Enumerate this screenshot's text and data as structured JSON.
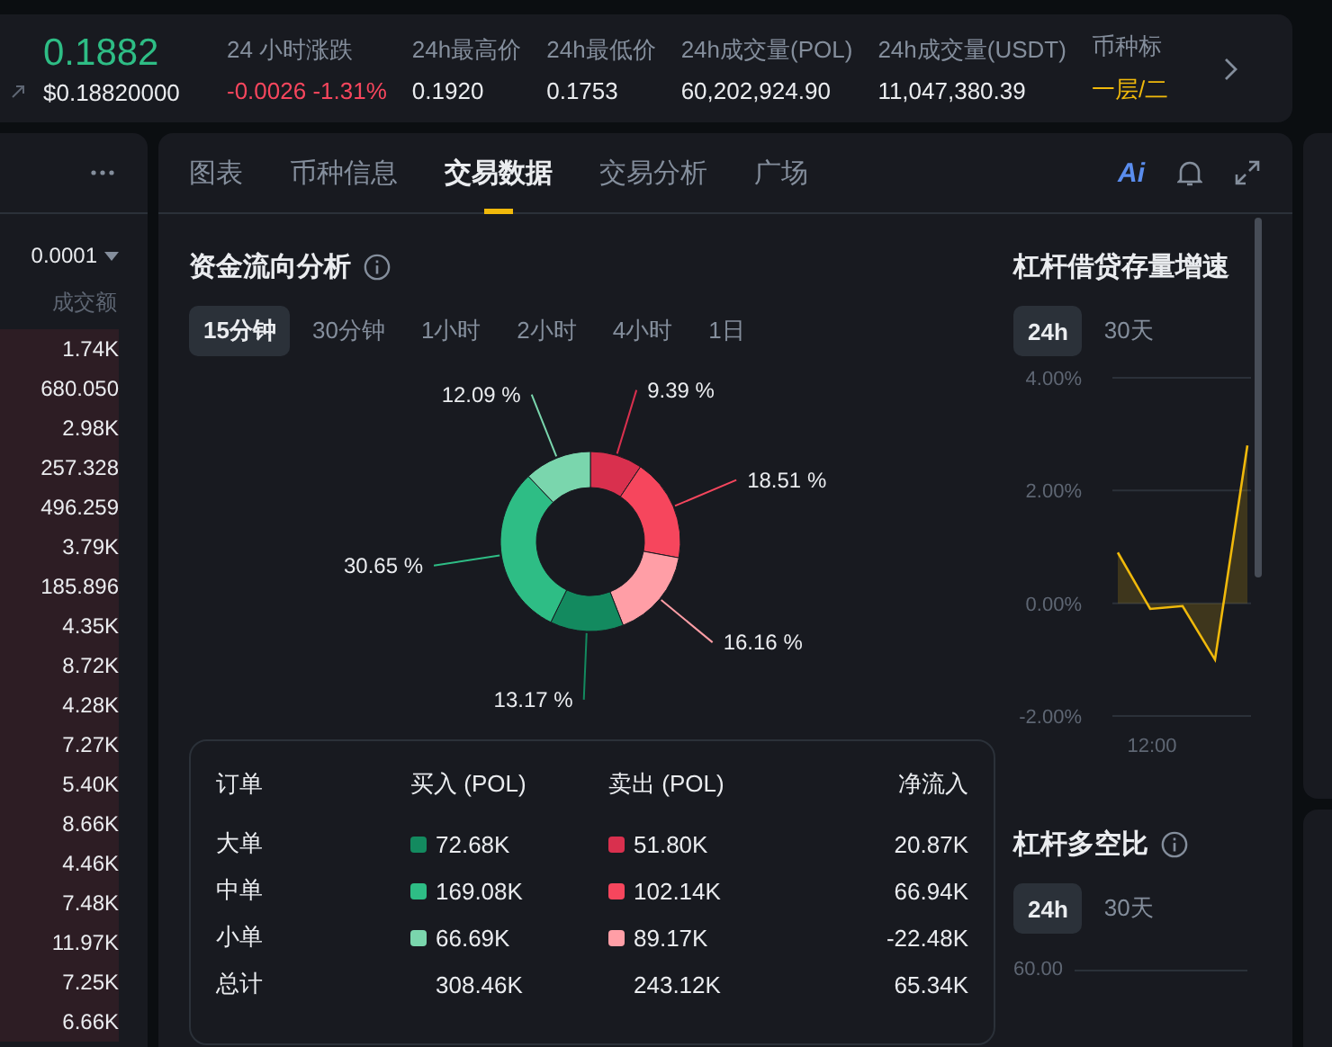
{
  "ticker": {
    "price": "0.1882",
    "price_usd": "$0.18820000",
    "stats": [
      {
        "label": "24 小时涨跌",
        "value": "-0.0026 -1.31%",
        "kind": "down"
      },
      {
        "label": "24h最高价",
        "value": "0.1920",
        "kind": "plain"
      },
      {
        "label": "24h最低价",
        "value": "0.1753",
        "kind": "plain"
      },
      {
        "label": "24h成交量(POL)",
        "value": "60,202,924.90",
        "kind": "plain"
      },
      {
        "label": "24h成交量(USDT)",
        "value": "11,047,380.39",
        "kind": "plain"
      },
      {
        "label": "币种标",
        "value": "一层/二",
        "kind": "tag"
      }
    ]
  },
  "order_book": {
    "tick_size": "0.0001",
    "column": "成交额",
    "rows": [
      "1.74K",
      "680.050",
      "2.98K",
      "257.328",
      "496.259",
      "3.79K",
      "185.896",
      "4.35K",
      "8.72K",
      "4.28K",
      "7.27K",
      "5.40K",
      "8.66K",
      "4.46K",
      "7.48K",
      "11.97K",
      "7.25K",
      "6.66K"
    ]
  },
  "tabs": [
    {
      "label": "图表",
      "selected": false
    },
    {
      "label": "币种信息",
      "selected": false
    },
    {
      "label": "交易数据",
      "selected": true
    },
    {
      "label": "交易分析",
      "selected": false
    },
    {
      "label": "广场",
      "selected": false
    }
  ],
  "ai_label": "Ai",
  "fund_flow": {
    "title": "资金流向分析",
    "periods": [
      {
        "label": "15分钟",
        "selected": true
      },
      {
        "label": "30分钟",
        "selected": false
      },
      {
        "label": "1小时",
        "selected": false
      },
      {
        "label": "2小时",
        "selected": false
      },
      {
        "label": "4小时",
        "selected": false
      },
      {
        "label": "1日",
        "selected": false
      }
    ],
    "chart_data": {
      "type": "donut",
      "values": [
        9.39,
        18.51,
        16.16,
        13.17,
        30.65,
        12.09
      ],
      "colors": [
        "#d9304e",
        "#f6465d",
        "#ff9ea6",
        "#138a5f",
        "#2ebd85",
        "#7ad6ad"
      ],
      "value_labels": [
        "9.39 %",
        "18.51 %",
        "16.16 %",
        "13.17 %",
        "30.65 %",
        "12.09 %"
      ]
    },
    "table": {
      "columns": [
        "订单",
        "买入 (POL)",
        "卖出 (POL)",
        "净流入"
      ],
      "rows": [
        {
          "label": "大单",
          "buy": {
            "value": "72.68K",
            "color": "#138a5f"
          },
          "sell": {
            "value": "51.80K",
            "color": "#d9304e"
          },
          "net": "20.87K"
        },
        {
          "label": "中单",
          "buy": {
            "value": "169.08K",
            "color": "#2ebd85"
          },
          "sell": {
            "value": "102.14K",
            "color": "#f6465d"
          },
          "net": "66.94K"
        },
        {
          "label": "小单",
          "buy": {
            "value": "66.69K",
            "color": "#7ad6ad"
          },
          "sell": {
            "value": "89.17K",
            "color": "#ff9ea6"
          },
          "net": "-22.48K"
        },
        {
          "label": "总计",
          "buy": {
            "value": "308.46K"
          },
          "sell": {
            "value": "243.12K"
          },
          "net": "65.34K"
        }
      ]
    }
  },
  "leverage_growth": {
    "title": "杠杆借贷存量增速",
    "ranges": [
      {
        "label": "24h",
        "selected": true
      },
      {
        "label": "30天",
        "selected": false
      }
    ],
    "chart_data": {
      "type": "area",
      "values": [
        0.9,
        -0.1,
        -0.05,
        -1.0,
        2.8
      ],
      "ylim": [
        -2,
        4
      ],
      "yticks": [
        {
          "value": 4,
          "label": "4.00%"
        },
        {
          "value": 2,
          "label": "2.00%"
        },
        {
          "value": 0,
          "label": "0.00%"
        },
        {
          "value": -2,
          "label": "-2.00%"
        }
      ]
    },
    "x_label": "12:00"
  },
  "long_short": {
    "title": "杠杆多空比",
    "ranges": [
      {
        "label": "24h",
        "selected": true
      },
      {
        "label": "30天",
        "selected": false
      }
    ],
    "axis_label": "60.00"
  }
}
